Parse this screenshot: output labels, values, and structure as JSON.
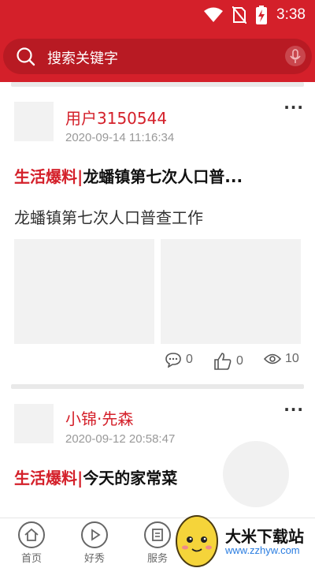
{
  "status_bar": {
    "time": "3:38"
  },
  "search": {
    "placeholder": "搜索关键字"
  },
  "posts": [
    {
      "username": "用户3150544",
      "timestamp": "2020-09-14 11:16:34",
      "category": "生活爆料|",
      "title": "龙蟠镇第七次人口普...",
      "summary": "龙蟠镇第七次人口普查工作",
      "comments": "0",
      "likes": "0",
      "views": "10"
    },
    {
      "username": "小锦·先森",
      "timestamp": "2020-09-12 20:58:47",
      "category": "生活爆料|",
      "title": "今天的家常菜"
    }
  ],
  "nav": {
    "items": [
      {
        "label": "首页"
      },
      {
        "label": "好秀"
      },
      {
        "label": "服务"
      }
    ]
  },
  "watermark": {
    "text": "大米下载站",
    "url": "www.zzhyw.com"
  },
  "colors": {
    "brand_red": "#d4202a",
    "muted": "#999999"
  }
}
